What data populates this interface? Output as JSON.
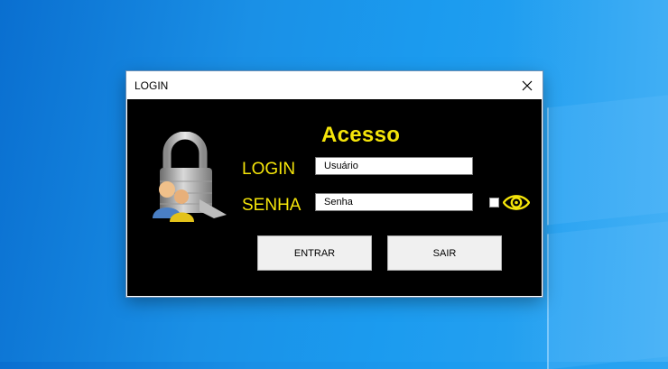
{
  "window": {
    "title": "LOGIN"
  },
  "form": {
    "heading": "Acesso",
    "login_label": "LOGIN",
    "senha_label": "SENHA",
    "login_value": "Usuário",
    "senha_value": "Senha"
  },
  "buttons": {
    "entrar": "ENTRAR",
    "sair": "SAIR"
  },
  "icons": {
    "close": "close-icon",
    "eye": "eye-icon",
    "lock": "padlock-users-icon"
  },
  "colors": {
    "accent": "#f5e50a",
    "panel": "#000000",
    "button": "#f0f0f0"
  }
}
